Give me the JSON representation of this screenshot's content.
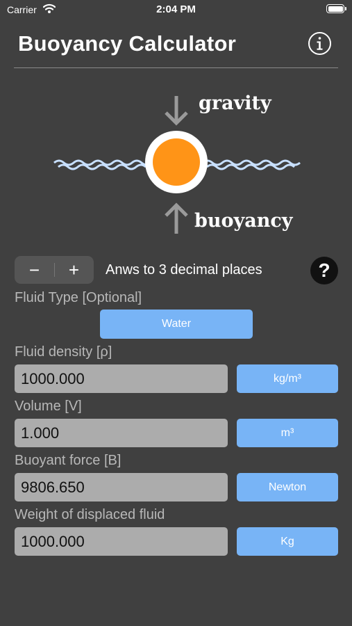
{
  "status_bar": {
    "carrier": "Carrier",
    "time": "2:04 PM",
    "icons": [
      "wifi-icon",
      "battery-icon"
    ]
  },
  "header": {
    "title": "Buoyancy Calculator",
    "info_icon": "info-icon"
  },
  "diagram": {
    "top_label": "gravity",
    "bottom_label": "buoyancy",
    "ball_color": "#ff9417",
    "wave_color": "#c8e0ff",
    "arrow_color": "#9a9a9a"
  },
  "precision": {
    "minus": "−",
    "plus": "+",
    "label": "Anws to 3 decimal places",
    "help": "?"
  },
  "form": {
    "fluid_type": {
      "label": "Fluid Type [Optional]",
      "button": "Water"
    },
    "density": {
      "label": "Fluid density [ρ]",
      "value": "1000.000",
      "unit": "kg/m³"
    },
    "volume": {
      "label": "Volume [V]",
      "value": "1.000",
      "unit": "m³"
    },
    "force": {
      "label": "Buoyant force [B]",
      "value": "9806.650",
      "unit": "Newton"
    },
    "weight": {
      "label": "Weight of displaced fluid",
      "value": "1000.000",
      "unit": "Kg"
    }
  },
  "colors": {
    "background": "#404040",
    "accent": "#78b4f6",
    "input_bg": "#acacac"
  }
}
